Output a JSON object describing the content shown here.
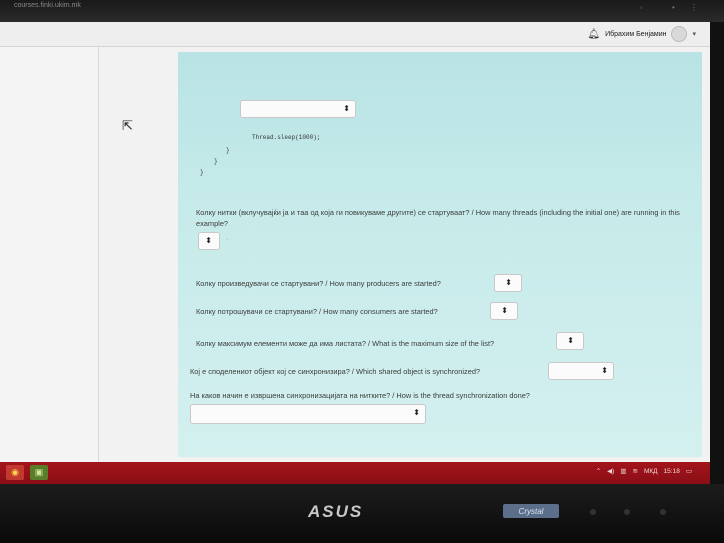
{
  "browser": {
    "url": "courses.finki.ukim.mk"
  },
  "header": {
    "user_name": "Ибрахим Бенјамин"
  },
  "code": {
    "line_sleep": "Thread.sleep(1000);",
    "brace_1": "}",
    "brace_2": "}",
    "brace_3": "}"
  },
  "questions": [
    {
      "text": "Колку нитки (вклучувајќи ја и таа од која ги повикуваме другите) се стартуваат? / How many threads (including the initial one) are running in this example?"
    },
    {
      "text": "Колку произведувачи се стартувани? / How many producers are started?"
    },
    {
      "text": "Колку потрошувачи се стартувани? / How many consumers are started?"
    },
    {
      "text": "Колку максимум елементи може да има листата? / What is the maximum size of the list?"
    },
    {
      "text": "Кој е споделениот објект кој се синхронизира? / Which shared object is synchronized?"
    },
    {
      "text": "На каков начин е извршена синхронизацијата на нитките? / How is the thread synchronization done?"
    }
  ],
  "select_arrow": "⬍",
  "taskbar": {
    "language": "МКД",
    "time": "15:18"
  },
  "monitor": {
    "brand": "ASUS",
    "badge": "Crystal"
  }
}
